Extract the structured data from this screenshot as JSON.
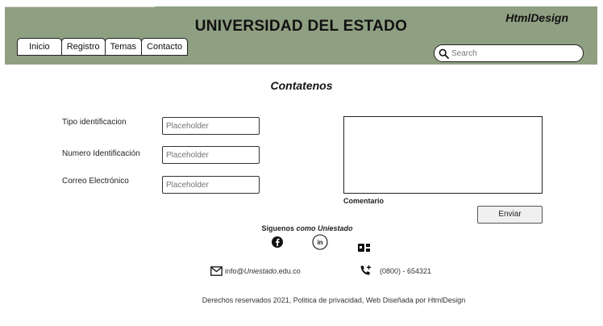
{
  "header": {
    "title": "UNIVERSIDAD DEL ESTADO",
    "brand": "HtmlDesign",
    "nav": [
      "Inicio",
      "Registro",
      "Temas",
      "Contacto"
    ],
    "search_placeholder": "Search",
    "background_color": "#8f9f82"
  },
  "main": {
    "page_title": "Contatenos",
    "form": {
      "fields": [
        {
          "label": "Tipo identificacion",
          "placeholder": "Placeholder"
        },
        {
          "label": "Numero Identificación",
          "placeholder": "Placeholder"
        },
        {
          "label": "Correo Electrónico",
          "placeholder": "Placeholder"
        }
      ],
      "comment_label": "Comentario",
      "submit_label": "Enviar"
    }
  },
  "social": {
    "follow_prefix": "Síguenos ",
    "follow_italic": "como Uniestado",
    "icons": [
      "facebook-icon",
      "linkedin-icon",
      "app-icon"
    ]
  },
  "contact": {
    "email_user": "info@",
    "email_italic": "Uniestado",
    "email_domain": ".edu.co",
    "phone": "(0800) - 654321"
  },
  "footer": {
    "text": "Derechos reservados 2021, Politica de privacidad, Web Diseñada por HtmlDesign"
  }
}
